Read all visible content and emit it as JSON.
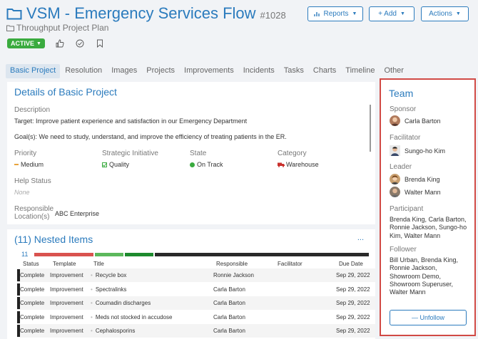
{
  "header": {
    "title": "VSM - Emergency Services Flow",
    "project_id": "#1028",
    "subtitle": "Throughput Project Plan",
    "status_badge": "ACTIVE",
    "buttons": {
      "reports": "Reports",
      "add": "+ Add",
      "actions": "Actions"
    }
  },
  "tabs": [
    "Basic Project",
    "Resolution",
    "Images",
    "Projects",
    "Improvements",
    "Incidents",
    "Tasks",
    "Charts",
    "Timeline",
    "Other"
  ],
  "details": {
    "title": "Details of Basic Project",
    "description_label": "Description",
    "target_text": "Target: Improve patient experience and satisfaction in our Emergency Department",
    "goals_text": "Goal(s): We need to study, understand, and improve the efficiency of treating patients in the ER.",
    "fields": {
      "priority_label": "Priority",
      "priority_value": "Medium",
      "initiative_label": "Strategic Initiative",
      "initiative_value": "Quality",
      "state_label": "State",
      "state_value": "On Track",
      "category_label": "Category",
      "category_value": "Warehouse"
    },
    "help_status_label": "Help Status",
    "help_status_value": "None",
    "responsible_label_1": "Responsible",
    "responsible_label_2": "Location(s)",
    "responsible_value": "ABC Enterprise"
  },
  "nested": {
    "title": "(11) Nested Items",
    "count": "11",
    "ellipsis": "...",
    "progress_segments": [
      {
        "fraction": 0.181,
        "color": "#d9534f"
      },
      {
        "fraction": 0.09,
        "color": "#5cb85c"
      },
      {
        "fraction": 0.09,
        "color": "#1e8a2e"
      },
      {
        "fraction": 0.639,
        "color": "#2a2a2a"
      }
    ],
    "columns": [
      "Status",
      "Template",
      "Title",
      "Responsible",
      "Facilitator",
      "Due Date"
    ],
    "rows": [
      {
        "status": "Complete",
        "template": "Improvement",
        "title": "Recycle box",
        "responsible": "Ronnie Jackson",
        "facilitator": "",
        "due": "Sep 29, 2022"
      },
      {
        "status": "Complete",
        "template": "Improvement",
        "title": "Spectralinks",
        "responsible": "Carla Barton",
        "facilitator": "",
        "due": "Sep 29, 2022"
      },
      {
        "status": "Complete",
        "template": "Improvement",
        "title": "Coumadin discharges",
        "responsible": "Carla Barton",
        "facilitator": "",
        "due": "Sep 29, 2022"
      },
      {
        "status": "Complete",
        "template": "Improvement",
        "title": "Meds not stocked in accudose",
        "responsible": "Carla Barton",
        "facilitator": "",
        "due": "Sep 29, 2022"
      },
      {
        "status": "Complete",
        "template": "Improvement",
        "title": "Cephalosporins",
        "responsible": "Carla Barton",
        "facilitator": "",
        "due": "Sep 29, 2022"
      }
    ]
  },
  "team": {
    "title": "Team",
    "sponsor_label": "Sponsor",
    "sponsor": "Carla Barton",
    "facilitator_label": "Facilitator",
    "facilitator": "Sungo-ho Kim",
    "leader_label": "Leader",
    "leaders": [
      "Brenda King",
      "Walter Mann"
    ],
    "participant_label": "Participant",
    "participants": "Brenda King, Carla Barton, Ronnie Jackson, Sungo-ho Kim, Walter Mann",
    "follower_label": "Follower",
    "followers": "Bill Urban, Brenda King, Ronnie Jackson, Showroom Demo, Showroom Superuser, Walter Mann",
    "unfollow_label": "— Unfollow"
  },
  "colors": {
    "accent": "#2b7bbd",
    "active": "#3aab3f",
    "highlight_border": "#d14a45"
  }
}
